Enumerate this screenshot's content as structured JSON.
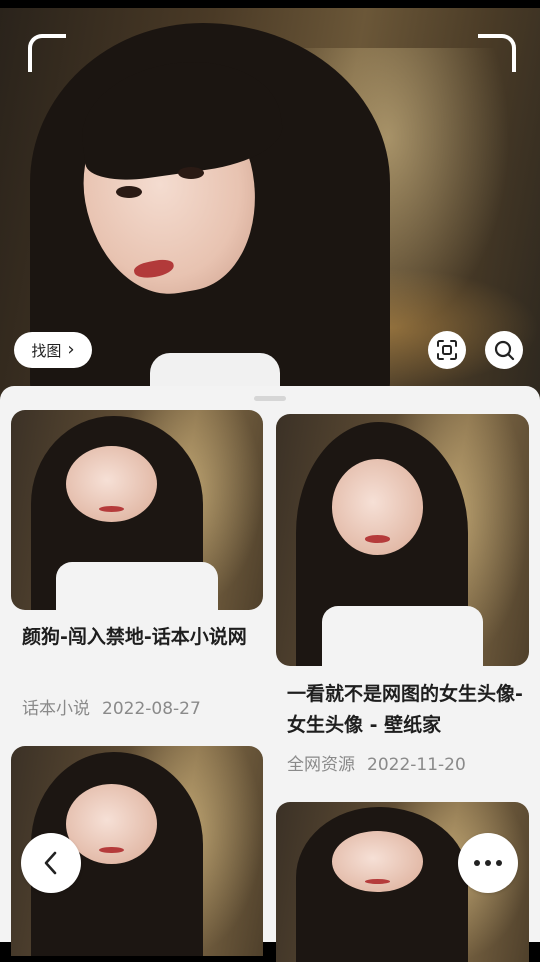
{
  "hero": {
    "find_button_label": "找图",
    "scan_icon": "scan-frame-icon",
    "search_icon": "search-icon"
  },
  "results": [
    {
      "title": "颜狗-闯入禁地-话本小说网",
      "source": "话本小说",
      "date": "2022-08-27"
    },
    {
      "title": "一看就不是网图的女生头像-女生头像 - 壁纸家",
      "source": "全网资源",
      "date": "2022-11-20"
    }
  ],
  "controls": {
    "back_icon": "chevron-left-icon",
    "more_icon": "more-dots-icon"
  },
  "colors": {
    "sheet_background": "#f3f3f3",
    "title_text": "#1e1e1e",
    "meta_text": "#8a8a8a"
  }
}
